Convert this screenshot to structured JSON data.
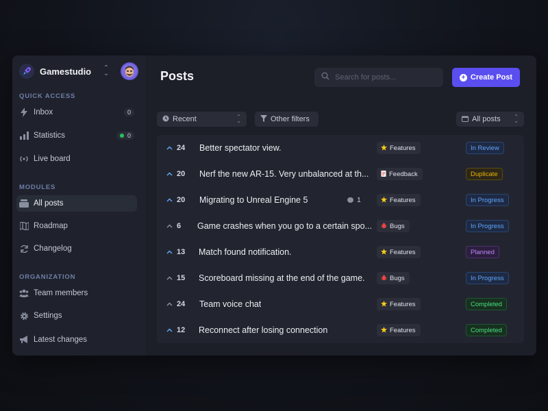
{
  "workspace": {
    "name": "Gamestudio",
    "logo_icon": "rocket-icon",
    "accent": "#6c5ce7"
  },
  "sidebar": {
    "quick_access_title": "QUICK ACCESS",
    "quick_access": [
      {
        "label": "Inbox",
        "icon": "bolt-icon",
        "count": "0"
      },
      {
        "label": "Statistics",
        "icon": "bar-chart-icon",
        "count": "0",
        "status_dot": "#22c55e"
      },
      {
        "label": "Live board",
        "icon": "live-icon"
      }
    ],
    "modules_title": "MODULES",
    "modules": [
      {
        "label": "All posts",
        "icon": "stack-icon",
        "active": true
      },
      {
        "label": "Roadmap",
        "icon": "map-icon"
      },
      {
        "label": "Changelog",
        "icon": "refresh-icon"
      }
    ],
    "org_title": "ORGANIZATION",
    "organization": [
      {
        "label": "Team members",
        "icon": "users-icon"
      },
      {
        "label": "Settings",
        "icon": "gear-icon"
      },
      {
        "label": "Latest changes",
        "icon": "megaphone-icon"
      }
    ]
  },
  "header": {
    "title": "Posts",
    "search_placeholder": "Search for posts...",
    "create_label": "Create Post",
    "accent": "#5b4ef0"
  },
  "filters": {
    "sort": "Recent",
    "other": "Other filters",
    "view": "All posts"
  },
  "posts": [
    {
      "votes": "24",
      "voted": true,
      "title": "Better spectator view.",
      "category": "Features",
      "status": "In Review"
    },
    {
      "votes": "20",
      "voted": true,
      "title": "Nerf the new AR-15. Very unbalanced at th...",
      "category": "Feedback",
      "status": "Duplicate"
    },
    {
      "votes": "20",
      "voted": true,
      "title": "Migrating to Unreal Engine 5",
      "comments": "1",
      "category": "Features",
      "status": "In Progress"
    },
    {
      "votes": "6",
      "voted": false,
      "title": "Game crashes when you go to a certain spo...",
      "category": "Bugs",
      "status": "In Progress"
    },
    {
      "votes": "13",
      "voted": true,
      "title": "Match found notification.",
      "category": "Features",
      "status": "Planned"
    },
    {
      "votes": "15",
      "voted": false,
      "title": "Scoreboard missing at the end of the game.",
      "category": "Bugs",
      "status": "In Progress"
    },
    {
      "votes": "24",
      "voted": false,
      "title": "Team voice chat",
      "category": "Features",
      "status": "Completed"
    },
    {
      "votes": "12",
      "voted": true,
      "title": "Reconnect after losing connection",
      "category": "Features",
      "status": "Completed"
    }
  ],
  "category_icons": {
    "Features": "star-icon",
    "Feedback": "note-icon",
    "Bugs": "bug-icon"
  },
  "status_colors": {
    "In Review": {
      "fg": "#60a5fa",
      "bg": "#1e2a44",
      "border": "#2b4572"
    },
    "Duplicate": {
      "fg": "#eab308",
      "bg": "#2c2716",
      "border": "#5a4a12"
    },
    "In Progress": {
      "fg": "#60a5fa",
      "bg": "#1e2a44",
      "border": "#2b4572"
    },
    "Planned": {
      "fg": "#c084fc",
      "bg": "#2c1f3e",
      "border": "#4c2f6e"
    },
    "Completed": {
      "fg": "#4ade80",
      "bg": "#17301f",
      "border": "#1f5633"
    }
  },
  "vote_colors": {
    "voted": "#60a5fa",
    "not_voted": "#8a8fa0"
  }
}
